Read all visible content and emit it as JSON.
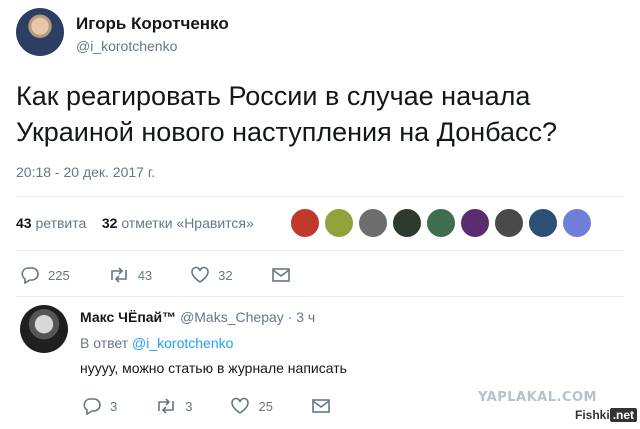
{
  "tweet": {
    "author_name": "Игорь Коротченко",
    "author_handle": "@i_korotchenko",
    "text": "Как реагировать России в случае начала Украиной нового наступления на Донбасс?",
    "timestamp": "20:18 - 20 дек. 2017 г.",
    "retweets_count": "43",
    "retweets_label": "ретвита",
    "likes_count": "32",
    "likes_label": "отметки «Нравится»",
    "actions": {
      "reply_count": "225",
      "retweet_count": "43",
      "like_count": "32"
    },
    "liker_colors": [
      "#c0392b",
      "#8fa33a",
      "#6d6d6d",
      "#2d3a2d",
      "#3f6e4e",
      "#5b2d6e",
      "#4a4a4a",
      "#2b4f77",
      "#6f7fd9"
    ]
  },
  "reply": {
    "name": "Макс ЧЁпай™",
    "handle": "@Maks_Chepay",
    "time": "3 ч",
    "reply_to_prefix": "В ответ",
    "reply_to_mention": "@i_korotchenko",
    "text": "нуууу, можно статью в журнале написать",
    "actions": {
      "reply_count": "3",
      "retweet_count": "3",
      "like_count": "25"
    }
  },
  "watermarks": {
    "yaplakal": "YAPLAKAL.COM",
    "fishki_prefix": "Fishki",
    "fishki_suffix": ".net"
  },
  "colors": {
    "text": "#14171a",
    "muted": "#657786",
    "link": "#1da1f2",
    "divider": "#e6ecf0"
  }
}
